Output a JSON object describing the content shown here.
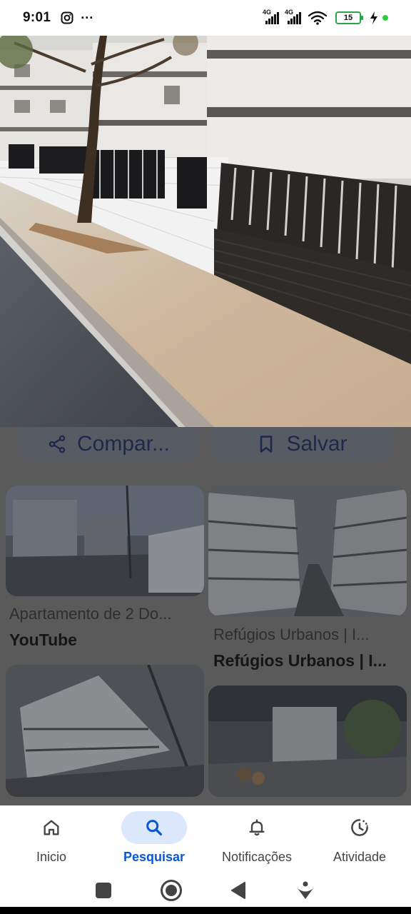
{
  "status_bar": {
    "time": "9:01",
    "more": "···",
    "network_1": "4G",
    "network_2": "4G",
    "battery": "15"
  },
  "actions": {
    "share_label": "Compar...",
    "save_label": "Salvar"
  },
  "results": [
    {
      "title": "Apartamento de 2 Do...",
      "source": "YouTube"
    },
    {
      "title": "Refúgios Urbanos | I...",
      "source": "Refúgios Urbanos | I..."
    }
  ],
  "bottom_nav": {
    "items": [
      {
        "label": "Inicio",
        "icon": "home-icon",
        "active": false
      },
      {
        "label": "Pesquisar",
        "icon": "search-icon",
        "active": true
      },
      {
        "label": "Notificações",
        "icon": "bell-icon",
        "active": false
      },
      {
        "label": "Atividade",
        "icon": "activity-icon",
        "active": false
      }
    ]
  },
  "colors": {
    "accent": "#0b57d0",
    "active_pill": "#dbe7fb",
    "battery_green": "#2aa34a"
  }
}
